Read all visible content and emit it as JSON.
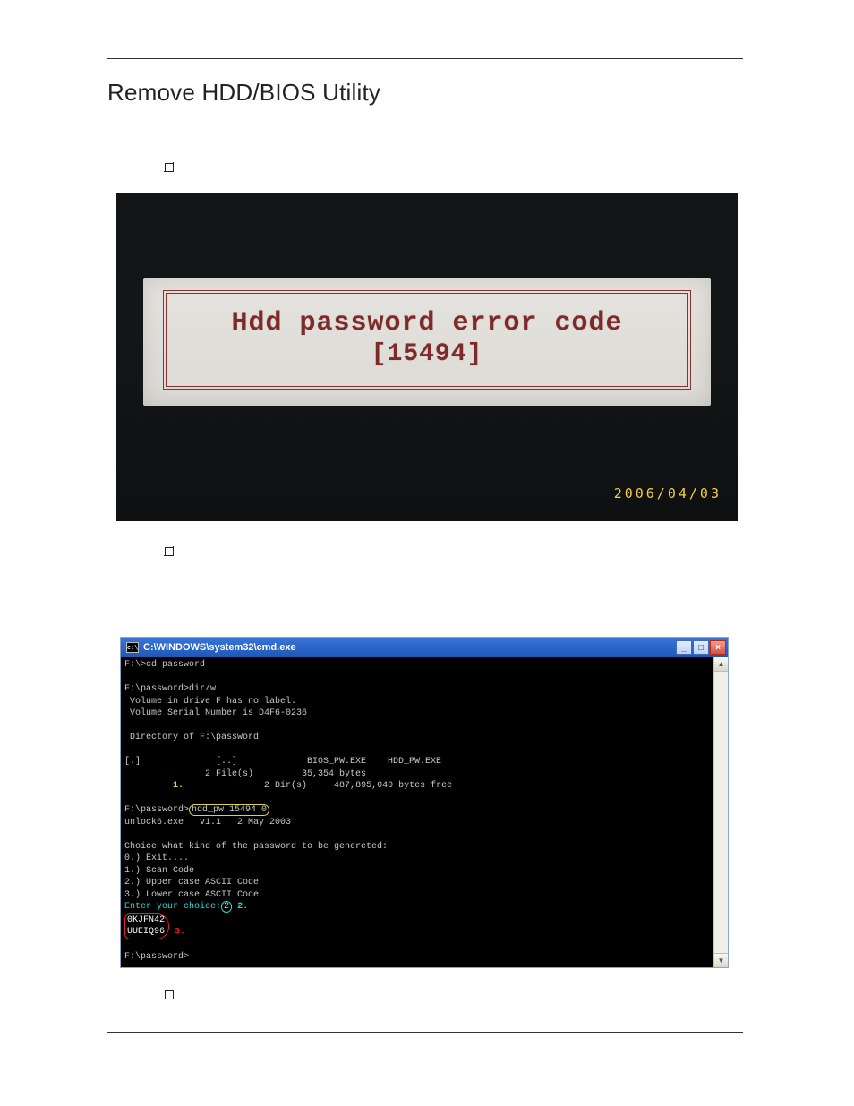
{
  "title": "Remove HDD/BIS Utility",
  "title_full": "Remove HDD/BIOS Utility",
  "bullets": {
    "b1": "",
    "b2": "",
    "b3": ""
  },
  "photo1": {
    "line1": "Hdd password error code",
    "line2": "[15494]",
    "date": "2006/04/03"
  },
  "cmd": {
    "title": "C:\\WINDOWS\\system32\\cmd.exe",
    "lines": {
      "l01": "F:\\>cd password",
      "l02": "",
      "l03": "F:\\password>dir/w",
      "l04": " Volume in drive F has no label.",
      "l05": " Volume Serial Number is D4F6-0236",
      "l06": "",
      "l07": " Directory of F:\\password",
      "l08": "",
      "l09": "[.]              [..]             BIOS_PW.EXE    HDD_PW.EXE",
      "l10": "               2 File(s)         35,354 bytes",
      "l11_num": "1.",
      "l11b": "               2 Dir(s)     487,895,040 bytes free",
      "l12": "",
      "l13_pre": "F:\\password>",
      "l13_cmd": "hdd_pw 15494 0",
      "l14": "unlock6.exe   v1.1   2 May 2003",
      "l15": "",
      "l16": "Choice what kind of the password to be genereted:",
      "l17": "0.) Exit....",
      "l18": "1.) Scan Code",
      "l19": "2.) Upper case ASCII Code",
      "l20": "3.) Lower case ASCII Code",
      "l21_pre": "Enter your choice:",
      "l21_val": "2",
      "l21_num": "2.",
      "l22a": "0KJFN42",
      "l22b": "UUEIQ96",
      "l22_num": "3.",
      "l23": "",
      "l24": "F:\\password>"
    }
  }
}
